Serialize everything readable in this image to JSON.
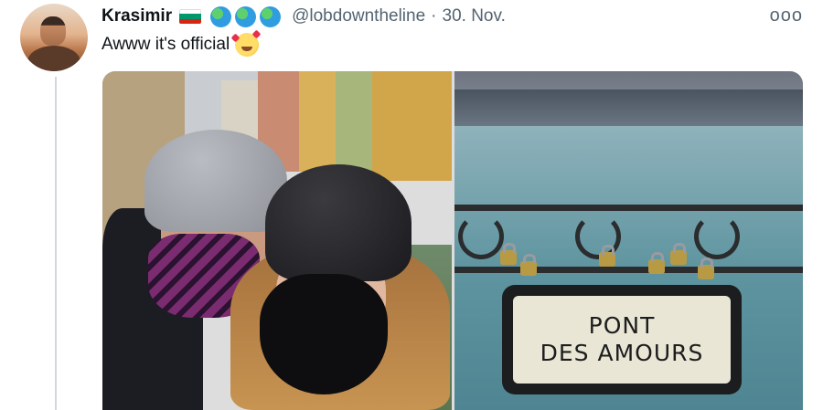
{
  "tweet": {
    "display_name": "Krasimir",
    "handle": "@lobdowntheline",
    "separator": "·",
    "date": "30. Nov.",
    "text": "Awww it's official",
    "more_glyph": "ooo"
  },
  "icons": {
    "flag": "bulgaria-flag-icon",
    "globes": [
      "globe-icon",
      "globe-icon",
      "globe-icon"
    ],
    "emoji": "smiling-face-with-hearts-icon",
    "more": "more-icon"
  },
  "flag_colors": [
    "#ffffff",
    "#00966e",
    "#d62612"
  ],
  "photos": {
    "right_sign_lines": [
      "PONT",
      "DES AMOURS"
    ]
  }
}
